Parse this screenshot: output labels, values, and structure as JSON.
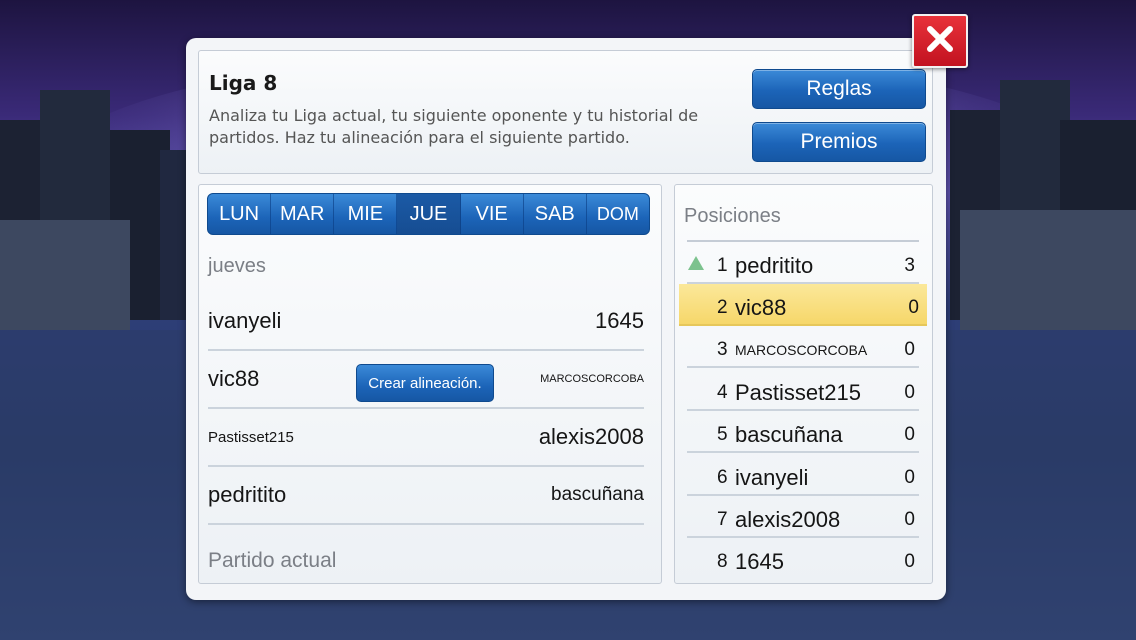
{
  "header": {
    "title": "Liga 8",
    "description": "Analiza tu Liga actual, tu siguiente oponente y tu historial de partidos. Haz tu alineación para el siguiente partido.",
    "rules_label": "Reglas",
    "prizes_label": "Premios"
  },
  "close_icon": "close-x-icon",
  "day_tabs": [
    {
      "label": "LUN",
      "active": false
    },
    {
      "label": "MAR",
      "active": false
    },
    {
      "label": "MIE",
      "active": false
    },
    {
      "label": "JUE",
      "active": true
    },
    {
      "label": "VIE",
      "active": false
    },
    {
      "label": "SAB",
      "active": false
    },
    {
      "label": "DOM",
      "active": false
    }
  ],
  "day_heading": "jueves",
  "matches": [
    {
      "home": "ivanyeli",
      "away": "1645"
    },
    {
      "home": "vic88",
      "away": "MARCOSCORCOBA",
      "action": "Crear alineación."
    },
    {
      "home": "Pastisset215",
      "away": "alexis2008"
    },
    {
      "home": "pedritito",
      "away": "bascuñana"
    }
  ],
  "current_match_heading": "Partido actual",
  "standings": {
    "title": "Posiciones",
    "rows": [
      {
        "rank": "1",
        "name": "pedritito",
        "points": "3",
        "trend": "up-arrow-icon"
      },
      {
        "rank": "2",
        "name": "vic88",
        "points": "0",
        "highlight": true
      },
      {
        "rank": "3",
        "name": "MARCOSCORCOBA",
        "points": "0"
      },
      {
        "rank": "4",
        "name": "Pastisset215",
        "points": "0"
      },
      {
        "rank": "5",
        "name": "bascuñana",
        "points": "0"
      },
      {
        "rank": "6",
        "name": "ivanyeli",
        "points": "0"
      },
      {
        "rank": "7",
        "name": "alexis2008",
        "points": "0"
      },
      {
        "rank": "8",
        "name": "1645",
        "points": "0"
      }
    ]
  },
  "colors": {
    "button_blue": "#1c64b8",
    "close_red": "#d0202a",
    "highlight_yellow": "#f6d76a",
    "trend_green": "#7cc28e"
  }
}
